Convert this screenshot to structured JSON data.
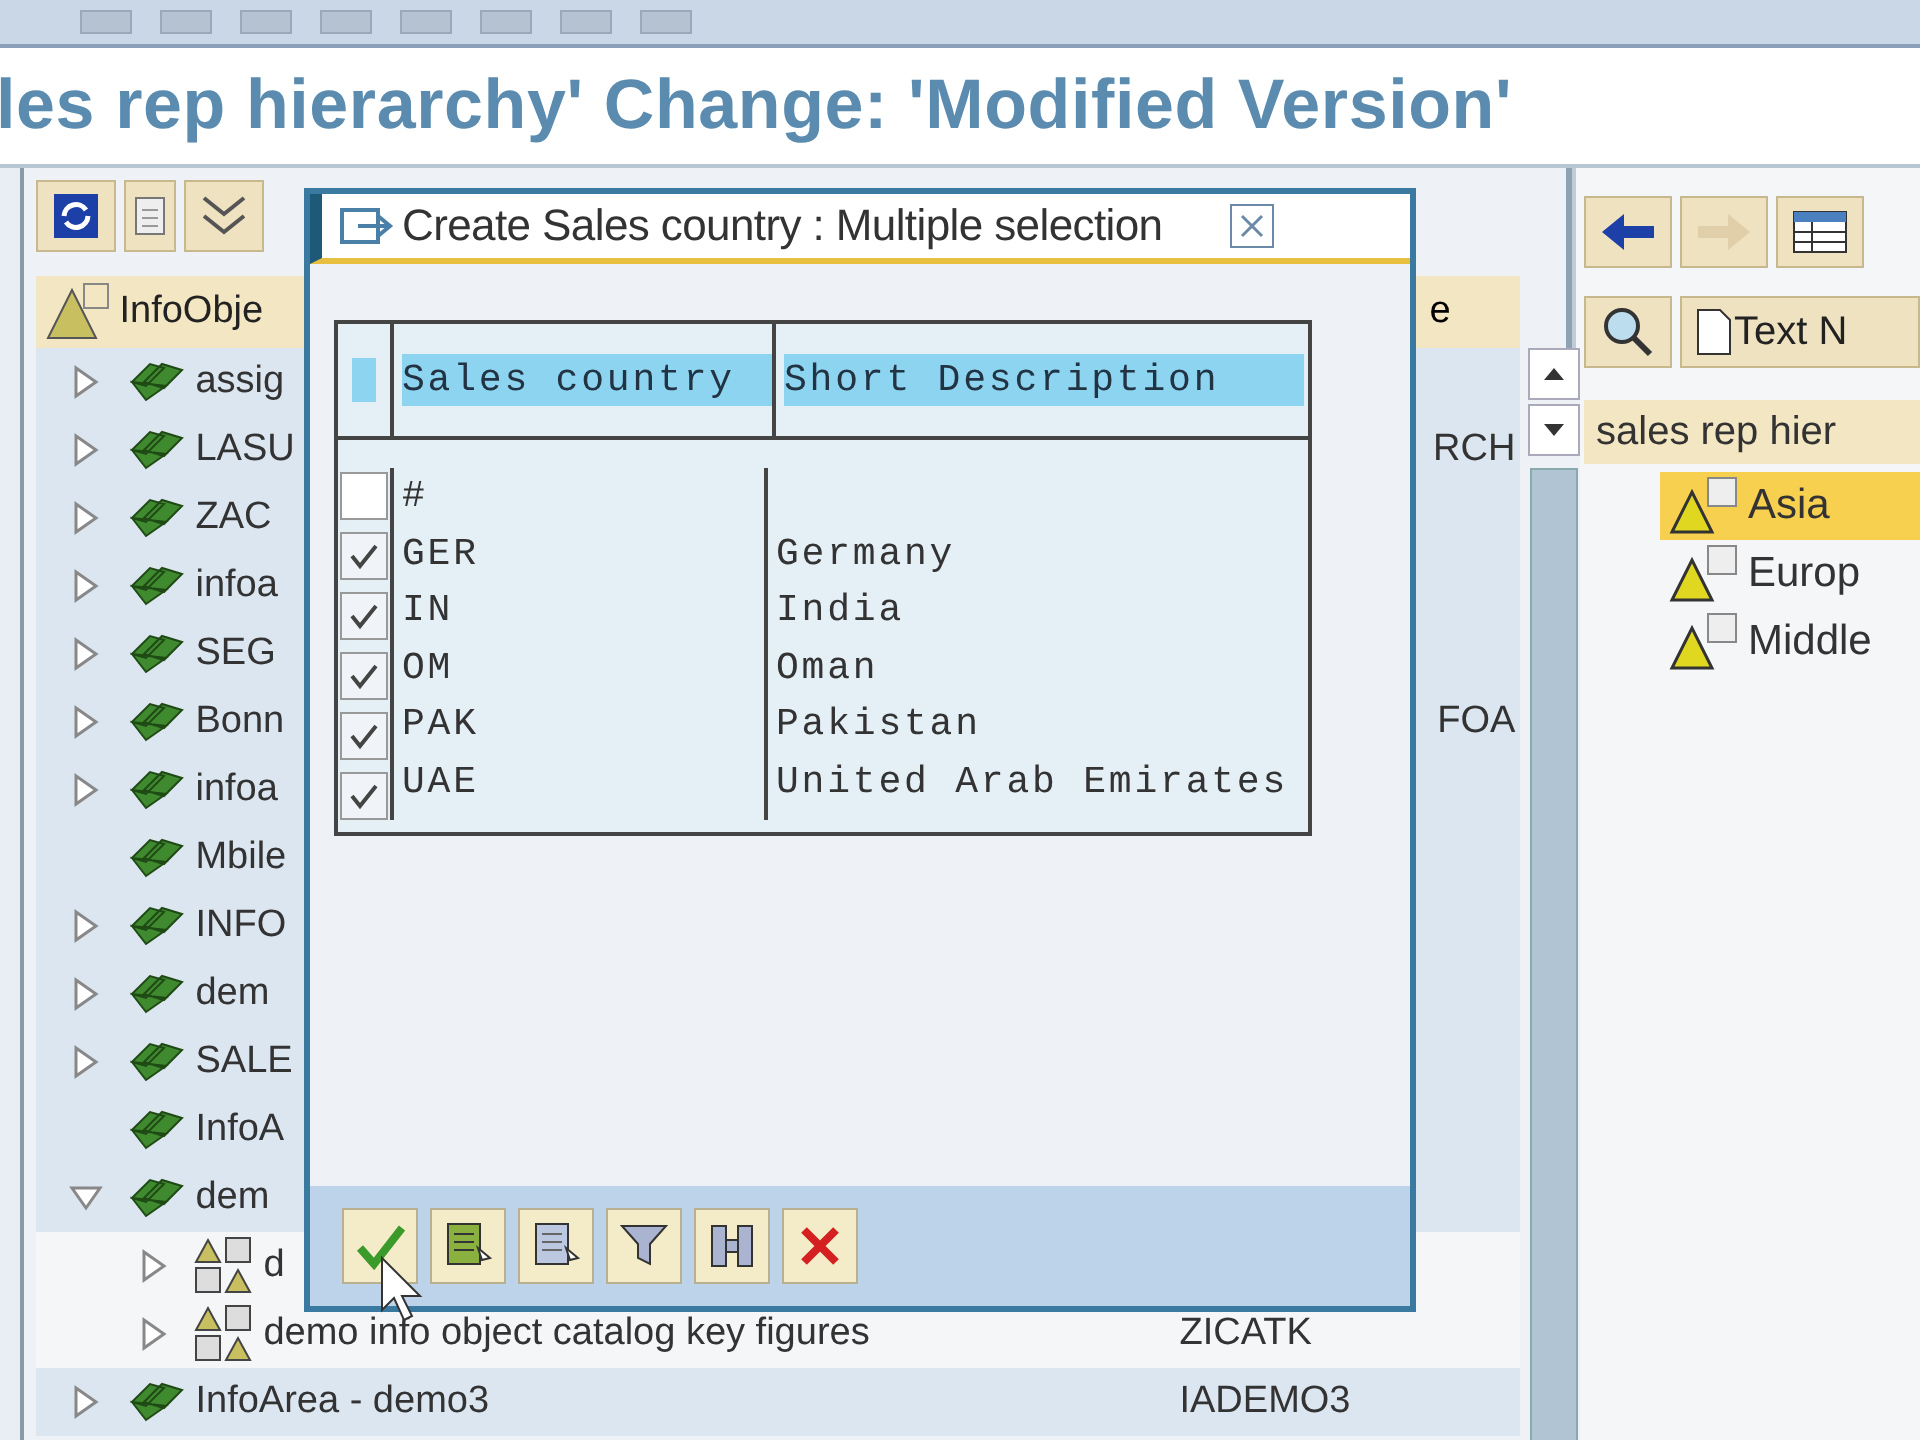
{
  "title": "les rep hierarchy' Change: 'Modified Version'",
  "left_panel": {
    "header": "InfoObje",
    "header_column_2": "e",
    "rows": [
      {
        "text": "assig",
        "expanded": false
      },
      {
        "text": "LASU",
        "code": "RCH",
        "expanded": false
      },
      {
        "text": "ZAC",
        "expanded": false
      },
      {
        "text": "infoa",
        "expanded": false
      },
      {
        "text": "SEG",
        "expanded": false
      },
      {
        "text": "Bonn",
        "code": "FOA",
        "expanded": false
      },
      {
        "text": "infoa",
        "expanded": false
      },
      {
        "text": "Mbile"
      },
      {
        "text": "INFO",
        "expanded": false
      },
      {
        "text": "dem",
        "expanded": false
      },
      {
        "text": "SALE",
        "expanded": false
      },
      {
        "text": "InfoA"
      },
      {
        "text": "dem",
        "expanded": true,
        "children": [
          {
            "text": "d",
            "expanded": false
          },
          {
            "text": "demo info object catalog key figures",
            "code": "ZICATK",
            "expanded": false
          }
        ]
      },
      {
        "text": "InfoArea - demo3",
        "code": "IADEMO3",
        "expanded": false
      }
    ]
  },
  "dialog": {
    "title": "Create Sales country : Multiple selection",
    "columns": [
      "Sales country",
      "Short Description"
    ],
    "rows": [
      {
        "code": "#",
        "checked": false
      },
      {
        "code": "GER",
        "description": "Germany",
        "checked": true
      },
      {
        "code": "IN",
        "description": "India",
        "checked": true
      },
      {
        "code": "OM",
        "description": "Oman",
        "checked": true
      },
      {
        "code": "PAK",
        "description": "Pakistan",
        "checked": true
      },
      {
        "code": "UAE",
        "description": "United Arab Emirates",
        "checked": true
      }
    ]
  },
  "right_panel": {
    "button": "Text N",
    "header": "sales rep hier",
    "items": [
      {
        "label": "Asia",
        "selected": true
      },
      {
        "label": "Europ",
        "selected": false
      },
      {
        "label": "Middle",
        "selected": false
      }
    ]
  }
}
